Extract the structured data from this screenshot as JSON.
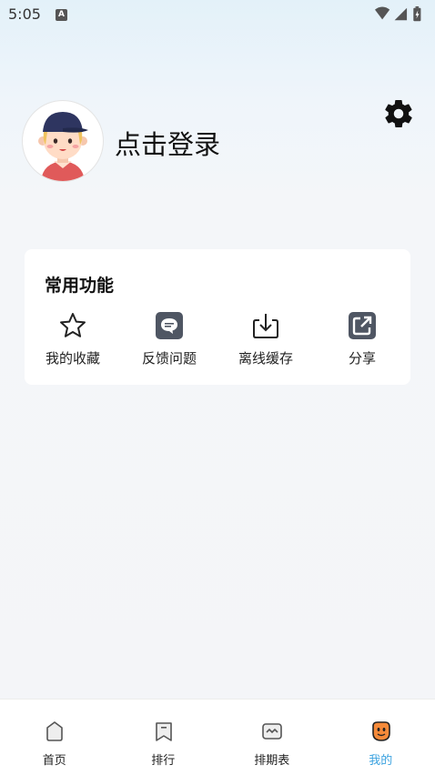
{
  "status_bar": {
    "time": "5:05",
    "notification_icon": "text-a-icon",
    "icons": [
      "wifi-icon",
      "signal-icon",
      "battery-charging-icon"
    ]
  },
  "profile": {
    "avatar_icon": "avatar-boy-cap-icon",
    "login_label": "点击登录",
    "settings_icon": "gear-icon"
  },
  "functions": {
    "title": "常用功能",
    "items": [
      {
        "label": "我的收藏",
        "icon": "star-icon"
      },
      {
        "label": "反馈问题",
        "icon": "feedback-chat-icon"
      },
      {
        "label": "离线缓存",
        "icon": "download-icon"
      },
      {
        "label": "分享",
        "icon": "share-icon"
      }
    ]
  },
  "tabbar": {
    "items": [
      {
        "label": "首页",
        "icon": "home-icon",
        "active": false
      },
      {
        "label": "排行",
        "icon": "bookmark-ranking-icon",
        "active": false
      },
      {
        "label": "排期表",
        "icon": "schedule-icon",
        "active": false
      },
      {
        "label": "我的",
        "icon": "mine-face-icon",
        "active": true
      }
    ],
    "active_color": "#3da3e0"
  }
}
